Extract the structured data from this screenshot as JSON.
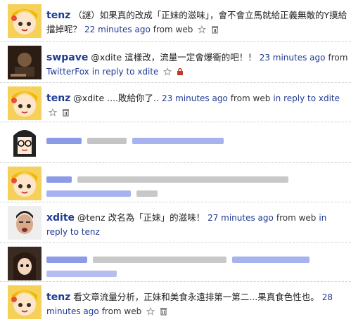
{
  "tweets": [
    {
      "user": "tenz",
      "text": "（謎）如果真的改成「正妹的滋味」，會不會立馬就給正義無敵的Y摸給擋掉呢？",
      "time": "22 minutes ago",
      "source": "from web",
      "reply_to": "",
      "avatar": "chibi-girl",
      "icons": [
        "star-icon",
        "trash-icon"
      ],
      "blurred": false
    },
    {
      "user": "swpave",
      "text": "@xdite 這樣改，流量一定會爆衝的吧！！",
      "time": "23 minutes ago",
      "source": "from",
      "source_link": "TwitterFox",
      "reply_to": "in reply to xdite",
      "avatar": "dark-photo",
      "icons": [
        "star-icon",
        "lock-icon"
      ],
      "blurred": false
    },
    {
      "user": "tenz",
      "text": "@xdite ....敗給你了..",
      "time": "23 minutes ago",
      "source": "from web",
      "reply_to": "in reply to xdite",
      "avatar": "chibi-girl",
      "icons": [
        "star-icon",
        "trash-icon"
      ],
      "blurred": false
    },
    {
      "user": "",
      "text": "",
      "time": "",
      "source": "",
      "reply_to": "",
      "avatar": "cartoon-glasses",
      "icons": [],
      "blurred": true
    },
    {
      "user": "",
      "text": "",
      "time": "",
      "source": "",
      "reply_to": "",
      "avatar": "chibi-girl",
      "icons": [],
      "blurred": true
    },
    {
      "user": "xdite",
      "text": "@tenz 改名為「正妹」的滋味！",
      "time": "27 minutes ago",
      "source": "from web",
      "reply_to": "in reply to tenz",
      "avatar": "man-photo",
      "icons": [],
      "blurred": false
    },
    {
      "user": "",
      "text": "",
      "time": "",
      "source": "",
      "reply_to": "",
      "avatar": "anime-girl",
      "icons": [],
      "blurred": true
    },
    {
      "user": "tenz",
      "text": "看文章流量分析，正妹和美食永遠排第一第二...果真食色性也。",
      "time": "28 minutes ago",
      "source": "from web",
      "reply_to": "",
      "avatar": "chibi-girl",
      "icons": [
        "star-icon",
        "trash-icon"
      ],
      "blurred": false
    }
  ],
  "colors": {
    "link": "#1f3a93",
    "divider": "#d4d4d4",
    "text": "#222222"
  }
}
